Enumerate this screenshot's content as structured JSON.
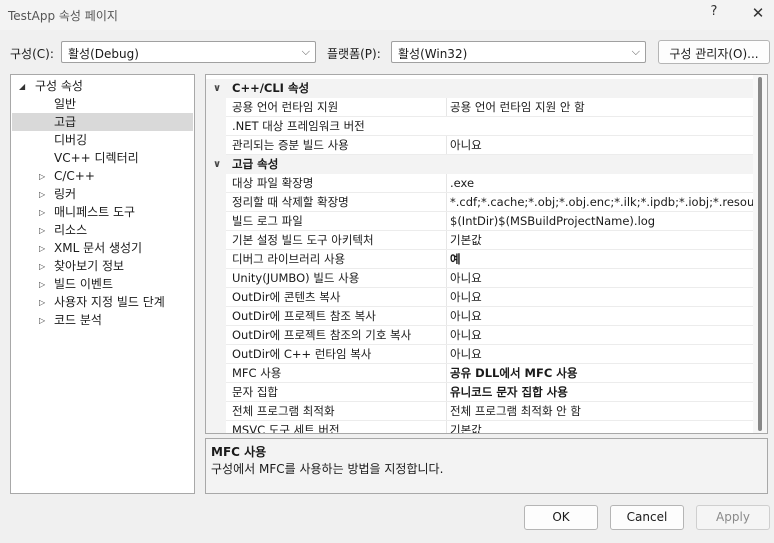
{
  "window": {
    "title": "TestApp 속성 페이지",
    "help": "?",
    "close": "✕"
  },
  "toolbar": {
    "config_label": "구성(C):",
    "config_value": "활성(Debug)",
    "platform_label": "플랫폼(P):",
    "platform_value": "활성(Win32)",
    "config_manager": "구성 관리자(O)..."
  },
  "tree": {
    "root": "구성 속성",
    "items": [
      "일반",
      "고급",
      "디버깅",
      "VC++ 디렉터리",
      "C/C++",
      "링커",
      "매니페스트 도구",
      "리소스",
      "XML 문서 생성기",
      "찾아보기 정보",
      "빌드 이벤트",
      "사용자 지정 빌드 단계",
      "코드 분석"
    ]
  },
  "grid": {
    "cat1": "C++/CLI 속성",
    "rows1": [
      {
        "name": "공용 언어 런타임 지원",
        "value": "공용 언어 런타임 지원 안 함"
      },
      {
        "name": ".NET 대상 프레임워크 버전",
        "value": ""
      },
      {
        "name": "관리되는 증분 빌드 사용",
        "value": "아니요"
      }
    ],
    "cat2": "고급 속성",
    "rows2": [
      {
        "name": "대상 파일 확장명",
        "value": ".exe"
      },
      {
        "name": "정리할 때 삭제할 확장명",
        "value": "*.cdf;*.cache;*.obj;*.obj.enc;*.ilk;*.ipdb;*.iobj;*.resources;*.tlb;*.tli;*.tlh;*.tmp"
      },
      {
        "name": "빌드 로그 파일",
        "value": "$(IntDir)$(MSBuildProjectName).log"
      },
      {
        "name": "기본 설정 빌드 도구 아키텍처",
        "value": "기본값"
      },
      {
        "name": "디버그 라이브러리 사용",
        "value": "예"
      },
      {
        "name": "Unity(JUMBO) 빌드 사용",
        "value": "아니요"
      },
      {
        "name": "OutDir에 콘텐츠 복사",
        "value": "아니요"
      },
      {
        "name": "OutDir에 프로젝트 참조 복사",
        "value": "아니요"
      },
      {
        "name": "OutDir에 프로젝트 참조의 기호 복사",
        "value": "아니요"
      },
      {
        "name": "OutDir에 C++ 런타임 복사",
        "value": "아니요"
      },
      {
        "name": "MFC 사용",
        "value": "공유 DLL에서 MFC 사용"
      },
      {
        "name": "문자 집합",
        "value": "유니코드 문자 집합 사용"
      },
      {
        "name": "전체 프로그램 최적화",
        "value": "전체 프로그램 최적화 안 함"
      },
      {
        "name": "MSVC 도구 세트 버전",
        "value": "기본값"
      }
    ]
  },
  "description": {
    "title": "MFC 사용",
    "text": "구성에서 MFC를 사용하는 방법을 지정합니다."
  },
  "buttons": {
    "ok": "OK",
    "cancel": "Cancel",
    "apply": "Apply"
  },
  "colors": {
    "selection": "#d9d9d9",
    "category_bg": "#f3f3f3",
    "disabled_text": "#8a8a8a"
  }
}
